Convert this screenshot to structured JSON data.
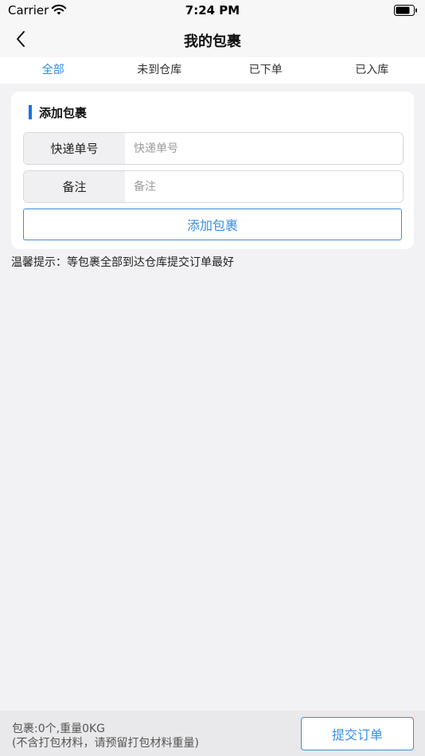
{
  "status_bar": {
    "carrier": "Carrier",
    "time": "7:24 PM",
    "icons": [
      "wifi-icon",
      "battery-icon"
    ]
  },
  "nav": {
    "title": "我的包裹",
    "back_icon": "chevron-left-icon"
  },
  "tabs": [
    {
      "label": "全部",
      "active": true
    },
    {
      "label": "未到仓库",
      "active": false
    },
    {
      "label": "已下单",
      "active": false
    },
    {
      "label": "已入库",
      "active": false
    }
  ],
  "card": {
    "title": "添加包裹",
    "fields": [
      {
        "label": "快递单号",
        "placeholder": "快递单号",
        "value": ""
      },
      {
        "label": "备注",
        "placeholder": "备注",
        "value": ""
      }
    ],
    "add_button": "添加包裹"
  },
  "tip": "温馨提示：等包裹全部到达仓库提交订单最好",
  "bottom": {
    "summary": "包裹:0个,重量0KG",
    "note": "(不含打包材料，请预留打包材料重量)",
    "submit_button": "提交订单"
  },
  "colors": {
    "accent": "#3a8ee6",
    "active_tab": "#2a8ce8",
    "background": "#f2f2f5"
  }
}
